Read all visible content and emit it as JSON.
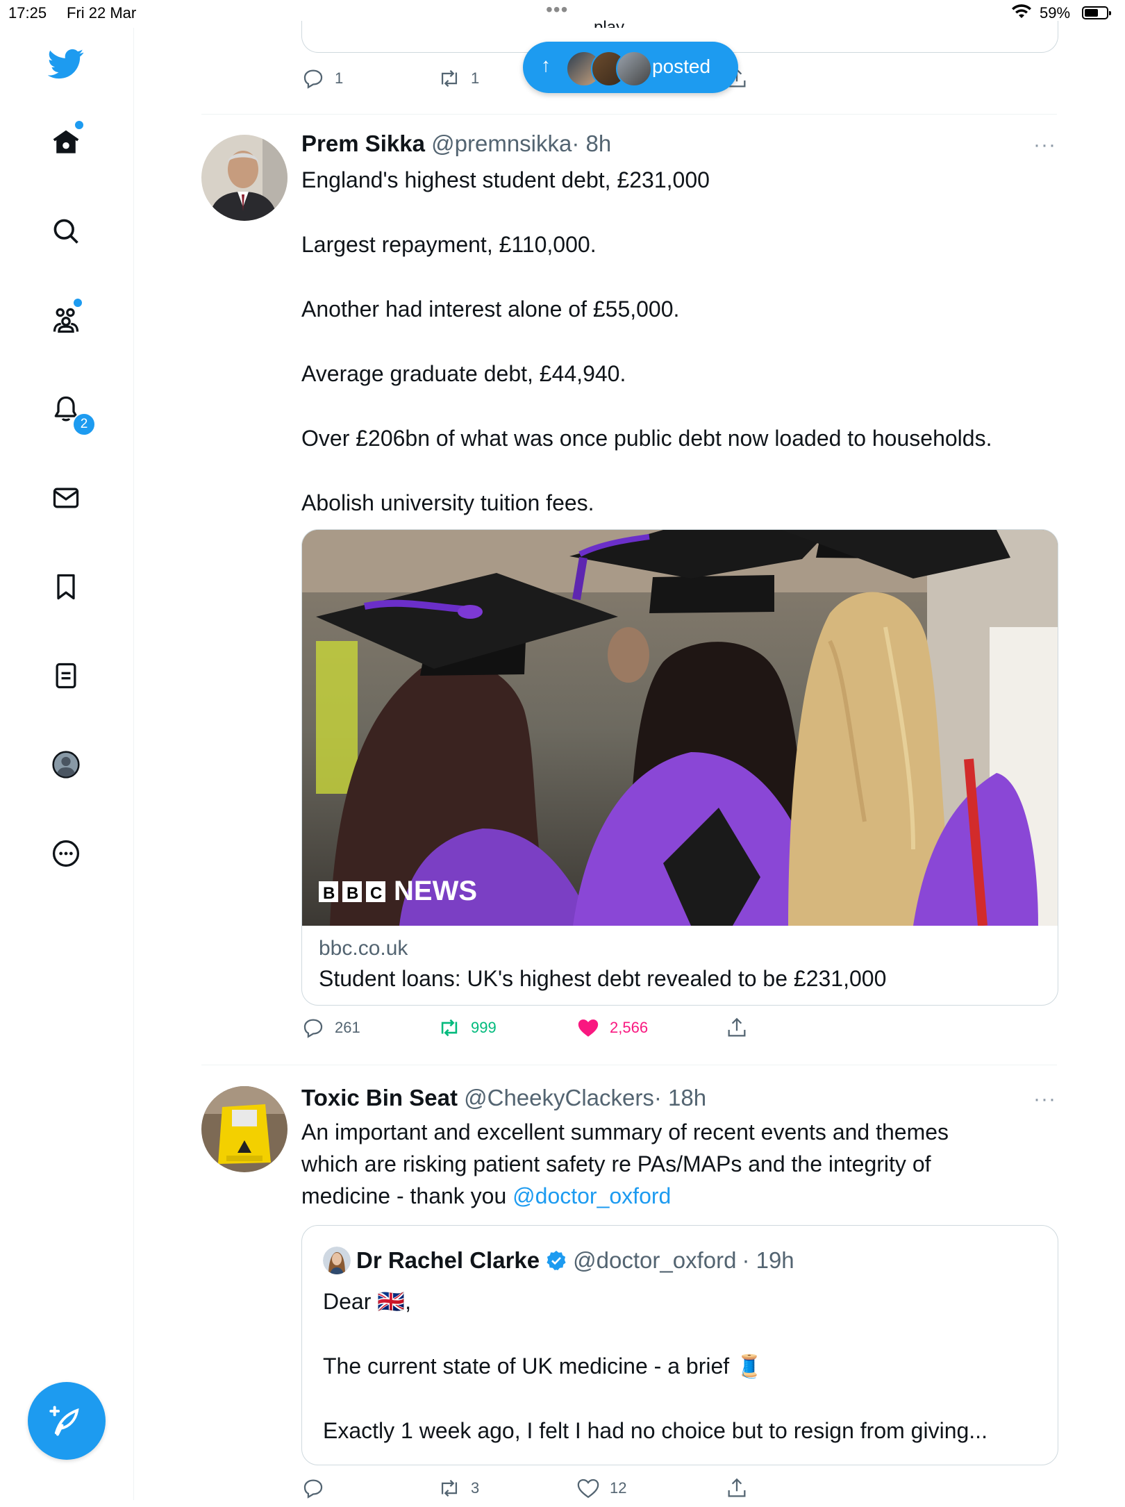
{
  "status_bar": {
    "time": "17:25",
    "date": "Fri 22 Mar",
    "battery": "59%"
  },
  "new_posts_pill": {
    "label": "posted"
  },
  "nav": {
    "notifications_badge": "2"
  },
  "previous_tweet": {
    "reply_count": "1",
    "retweet_count": "1"
  },
  "tweets": [
    {
      "name": "Prem Sikka",
      "handle": "@premnsikka",
      "time": "· 8h",
      "more": "···",
      "lines": [
        "England's highest student debt, £231,000",
        "Largest repayment, £110,000.",
        "Another had interest alone of £55,000.",
        "Average graduate debt,  £44,940.",
        "Over £206bn of what was once public debt now loaded to households.",
        "Abolish university tuition fees."
      ],
      "card": {
        "brand": "NEWS",
        "bbc_letters": [
          "B",
          "B",
          "C"
        ],
        "domain": "bbc.co.uk",
        "title": "Student loans: UK's highest debt revealed to be £231,000"
      },
      "replies": "261",
      "retweets": "999",
      "likes": "2,566"
    },
    {
      "name": "Toxic Bin Seat",
      "handle": "@CheekyClackers",
      "time": "· 18h",
      "more": "···",
      "text_line1": "An important and excellent summary of recent events and themes",
      "text_line2": "which are risking patient safety re PAs/MAPs and the integrity of",
      "text_line3": "medicine - thank you ",
      "mention": "@doctor_oxford",
      "quote": {
        "name": "Dr Rachel Clarke",
        "handle": "@doctor_oxford",
        "time": "· 19h",
        "line1": "Dear 🇬🇧,",
        "line2": "The current state of UK medicine - a brief 🧵",
        "line3": "Exactly 1 week ago, I felt I had no choice but to resign from giving..."
      },
      "replies": "",
      "retweets": "3",
      "likes": "12"
    }
  ],
  "colors": {
    "accent": "#1d9bf0",
    "like": "#f91880",
    "retweet": "#00ba7c",
    "muted": "#536471"
  }
}
